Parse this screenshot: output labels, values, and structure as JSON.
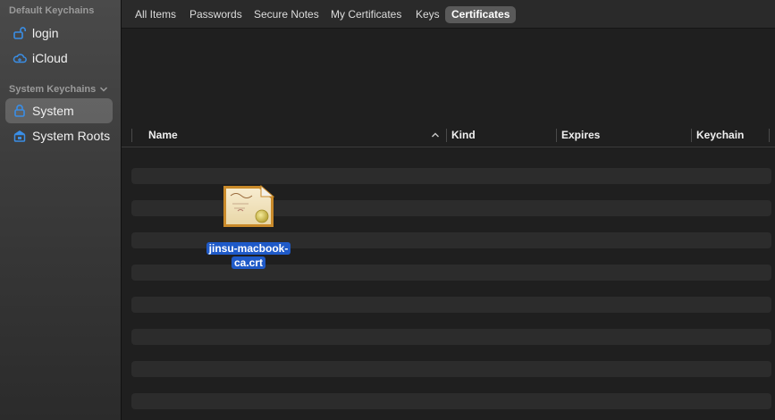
{
  "sidebar": {
    "default_header": "Default Keychains",
    "system_header": "System Keychains",
    "items": [
      {
        "label": "login",
        "icon": "lock-open-icon"
      },
      {
        "label": "iCloud",
        "icon": "cloud-icon"
      },
      {
        "label": "System",
        "icon": "lock-icon",
        "selected": true
      },
      {
        "label": "System Roots",
        "icon": "cabinet-icon"
      }
    ]
  },
  "tabs": [
    {
      "label": "All Items"
    },
    {
      "label": "Passwords"
    },
    {
      "label": "Secure Notes"
    },
    {
      "label": "My Certificates"
    },
    {
      "label": "Keys"
    },
    {
      "label": "Certificates",
      "active": true
    }
  ],
  "table": {
    "columns": [
      "Name",
      "Kind",
      "Expires",
      "Keychain"
    ],
    "sort": "ascending"
  },
  "dragged_file": {
    "name_line1": "jinsu-macbook-",
    "name_line2": "ca.crt",
    "icon": "certificate-icon"
  },
  "colors": {
    "accent_blue": "#1f5ac8",
    "icon_blue": "#3a8ee6"
  }
}
